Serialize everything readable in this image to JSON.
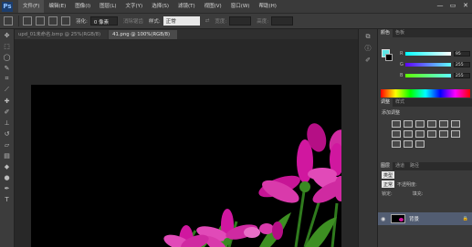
{
  "app": {
    "logo": "Ps"
  },
  "menu": [
    "文件(F)",
    "编辑(E)",
    "图像(I)",
    "图层(L)",
    "文字(Y)",
    "选择(S)",
    "滤镜(T)",
    "视图(V)",
    "窗口(W)",
    "帮助(H)"
  ],
  "window_controls": {
    "minimize": "—",
    "restore": "▭",
    "close": "✕"
  },
  "options": {
    "feather_label": "羽化:",
    "feather_value": "0 像素",
    "antialias_label": "消除锯齿",
    "style_label": "样式:",
    "style_value": "正常",
    "width_label": "宽度:",
    "height_label": "高度:"
  },
  "tabs": [
    {
      "label": "upd_01未命名.bmp @ 25%(RGB/8)",
      "active": false
    },
    {
      "label": "41.png @ 100%(RGB/8)",
      "active": true
    }
  ],
  "color_panel": {
    "tabs": [
      "颜色",
      "色板"
    ],
    "fg_color": "#5ee6e6",
    "bg_color": "#000000",
    "sliders": [
      {
        "letter": "R",
        "value": "95"
      },
      {
        "letter": "G",
        "value": "255"
      },
      {
        "letter": "B",
        "value": "255"
      }
    ]
  },
  "adjust_panel": {
    "tabs": [
      "调整",
      "样式"
    ],
    "add_label": "添加调整"
  },
  "layers_panel": {
    "tabs": [
      "图层",
      "通道",
      "路径"
    ],
    "kind_label": "类型",
    "blend_mode": "正常",
    "opacity_label": "不透明度:",
    "lock_label": "锁定:",
    "fill_label": "填充:",
    "layer_name": "背景"
  }
}
